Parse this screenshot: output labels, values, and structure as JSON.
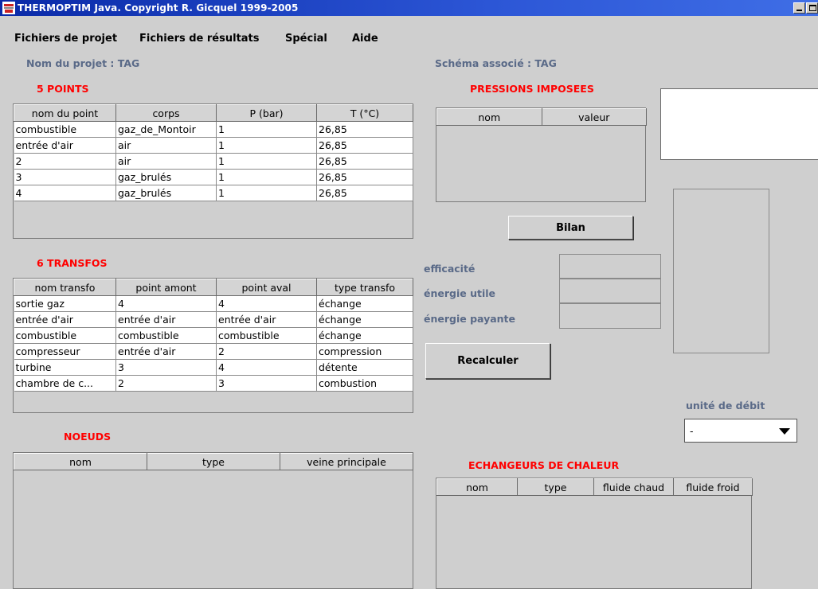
{
  "window": {
    "title": "THERMOPTIM Java. Copyright R. Gicquel 1999-2005"
  },
  "menu": [
    "Fichiers de projet",
    "Fichiers de résultats",
    "Spécial",
    "Aide"
  ],
  "project": {
    "name_label": "Nom du projet : TAG",
    "schema_label": "Schéma associé : TAG"
  },
  "points": {
    "title": "5  POINTS",
    "headers": [
      "nom du point",
      "corps",
      "P (bar)",
      "T (°C)"
    ],
    "rows": [
      [
        "combustible",
        "gaz_de_Montoir",
        "1",
        "26,85"
      ],
      [
        "entrée d'air",
        "air",
        "1",
        "26,85"
      ],
      [
        "2",
        "air",
        "1",
        "26,85"
      ],
      [
        "3",
        "gaz_brulés",
        "1",
        "26,85"
      ],
      [
        "4",
        "gaz_brulés",
        "1",
        "26,85"
      ]
    ]
  },
  "transfos": {
    "title": "6  TRANSFOS",
    "headers": [
      "nom transfo",
      "point amont",
      "point aval",
      "type transfo"
    ],
    "rows": [
      [
        "sortie gaz",
        "4",
        "4",
        "échange"
      ],
      [
        "entrée d'air",
        "entrée d'air",
        "entrée d'air",
        "échange"
      ],
      [
        "combustible",
        "combustible",
        "combustible",
        "échange"
      ],
      [
        "compresseur",
        "entrée d'air",
        "2",
        "compression"
      ],
      [
        "turbine",
        "3",
        "4",
        "détente"
      ],
      [
        "chambre de c...",
        "2",
        "3",
        "combustion"
      ]
    ]
  },
  "noeuds": {
    "title": "NOEUDS",
    "headers": [
      "nom",
      "type",
      "veine principale"
    ]
  },
  "pressions": {
    "title": "PRESSIONS IMPOSEES",
    "headers": [
      "nom",
      "valeur"
    ]
  },
  "bilan": {
    "button": "Bilan",
    "efficacite_label": "efficacité",
    "energie_utile_label": "énergie utile",
    "energie_payante_label": "énergie payante",
    "recalc_button": "Recalculer"
  },
  "debit": {
    "label": "unité de débit",
    "selected": "-"
  },
  "echangeurs": {
    "title": "ECHANGEURS DE CHALEUR",
    "headers": [
      "nom",
      "type",
      "fluide chaud",
      "fluide froid"
    ]
  },
  "colors": {
    "title_bar": "#0a2aa8",
    "section_red": "#ff0000",
    "label_blue": "#5a6a88",
    "background": "#cfcfcf"
  }
}
